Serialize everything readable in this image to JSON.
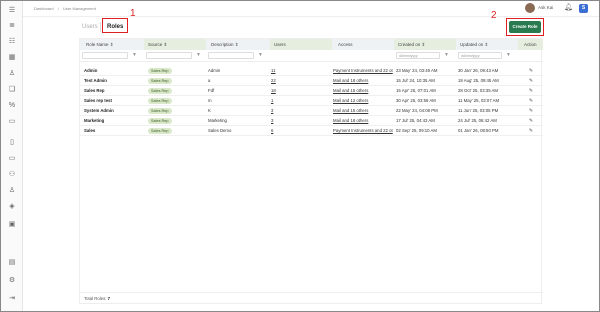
{
  "breadcrumb": [
    "Dashboard",
    "/",
    "User Management"
  ],
  "header": {
    "user_name": "Ask Kai",
    "user_initial": "S"
  },
  "tabs": [
    {
      "label": "Users"
    },
    {
      "label": "Roles"
    }
  ],
  "annotations": [
    "1",
    "2"
  ],
  "create_button": "Create Role",
  "columns": [
    "Role Name",
    "Source",
    "Description",
    "Users",
    "Access",
    "Created on",
    "Updated on",
    "Action"
  ],
  "filters": {
    "created_placeholder": "dd/mm/yyyy",
    "updated_placeholder": "dd/mm/yyyy"
  },
  "rows": [
    {
      "name": "Admin",
      "source": "Sales Rep",
      "description": "Admin",
      "users": "11",
      "access": "Payment Instruments and 22 ot",
      "created": "23 May' 24, 03:49 AM",
      "updated": "30 Jan' 26, 09:43 AM"
    },
    {
      "name": "Test Admin",
      "source": "Sales Rep",
      "description": "a",
      "users": "22",
      "access": "Mail and 18 others",
      "created": "15 Jul' 24, 10:35 AM",
      "updated": "19 Aug' 25, 09:45 AM"
    },
    {
      "name": "Sales Rep",
      "source": "Sales Rep",
      "description": "Fdf",
      "users": "18",
      "access": "Mail and 15 others",
      "created": "15 Apr' 25, 07:01 AM",
      "updated": "28 Oct' 25, 03:35 AM"
    },
    {
      "name": "Sales rep test",
      "source": "Sales Rep",
      "description": "m",
      "users": "1",
      "access": "Mail and 12 others",
      "created": "30 Apr' 25, 03:58 AM",
      "updated": "11 May' 25, 02:07 AM"
    },
    {
      "name": "System Admin",
      "source": "Sales Rep",
      "description": "K",
      "users": "3",
      "access": "Mail and 15 others",
      "created": "22 May' 24, 04:08 PM",
      "updated": "11 Jun' 25, 03:05 PM"
    },
    {
      "name": "Marketing",
      "source": "Sales Rep",
      "description": "Marketing",
      "users": "3",
      "access": "Mail and 18 others",
      "created": "17 Jul' 25, 04:43 AM",
      "updated": "24 Jul' 25, 06:42 AM"
    },
    {
      "name": "Sales",
      "source": "Sales Rep",
      "description": "Sales Demo",
      "users": "6",
      "access": "Payment Instruments and 22 ot",
      "created": "02 Sep' 25, 09:10 AM",
      "updated": "01 Jan' 26, 08:50 PM"
    }
  ],
  "footer": {
    "label": "Total Roles:",
    "count": "7"
  }
}
